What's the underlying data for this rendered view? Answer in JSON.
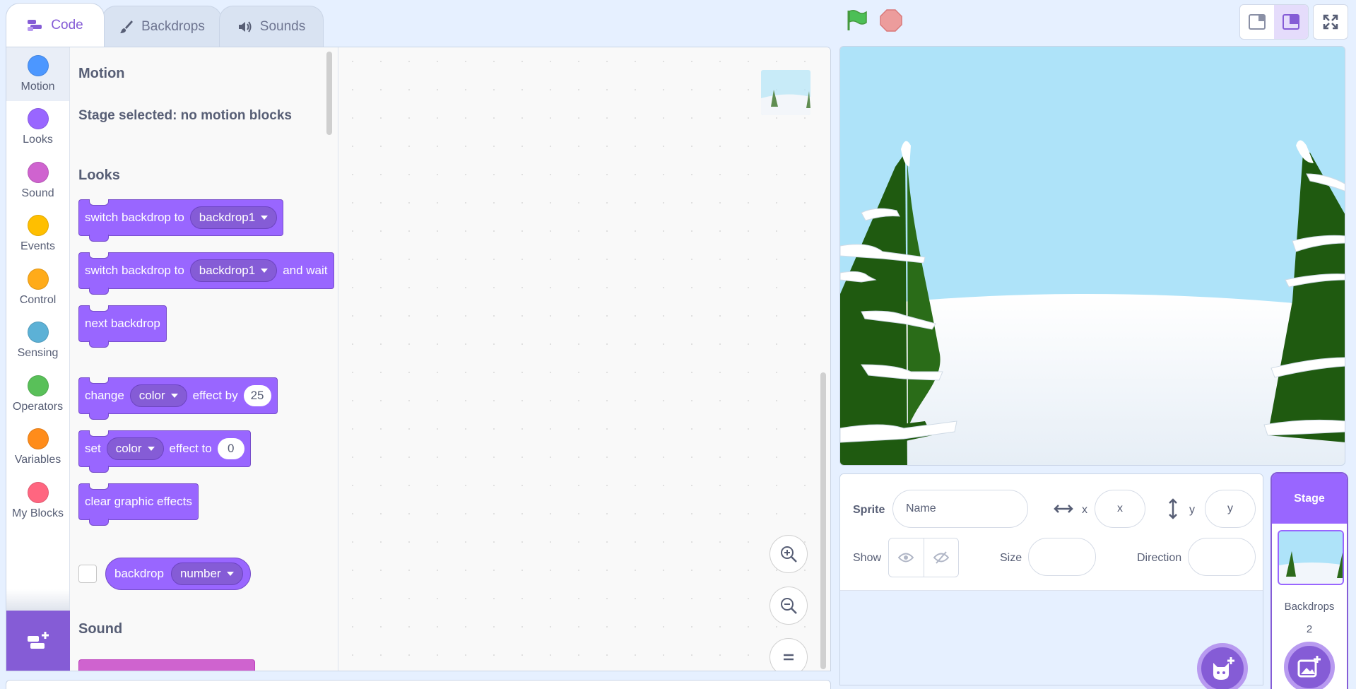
{
  "tabs": [
    {
      "label": "Code",
      "icon": "code-icon",
      "active": true
    },
    {
      "label": "Backdrops",
      "icon": "brush-icon",
      "active": false
    },
    {
      "label": "Sounds",
      "icon": "speaker-icon",
      "active": false
    }
  ],
  "categories": [
    {
      "label": "Motion",
      "color": "#4c97ff"
    },
    {
      "label": "Looks",
      "color": "#9966ff"
    },
    {
      "label": "Sound",
      "color": "#cf63cf"
    },
    {
      "label": "Events",
      "color": "#ffbf00"
    },
    {
      "label": "Control",
      "color": "#ffab19"
    },
    {
      "label": "Sensing",
      "color": "#5cb1d6"
    },
    {
      "label": "Operators",
      "color": "#59c059"
    },
    {
      "label": "Variables",
      "color": "#ff8c1a"
    },
    {
      "label": "My Blocks",
      "color": "#ff6680"
    }
  ],
  "flyout": {
    "motion_title": "Motion",
    "motion_note": "Stage selected: no motion blocks",
    "looks_title": "Looks",
    "sound_title": "Sound",
    "blocks": {
      "switch_backdrop": {
        "text": "switch backdrop to",
        "menu": "backdrop1"
      },
      "switch_backdrop_wait": {
        "text": "switch backdrop to",
        "menu": "backdrop1",
        "suffix": "and wait"
      },
      "next_backdrop": {
        "text": "next backdrop"
      },
      "change_effect": {
        "text": "change",
        "menu": "color",
        "mid": "effect by",
        "value": "25"
      },
      "set_effect": {
        "text": "set",
        "menu": "color",
        "mid": "effect to",
        "value": "0"
      },
      "clear_effects": {
        "text": "clear graphic effects"
      },
      "backdrop_reporter": {
        "text": "backdrop",
        "menu": "number"
      }
    }
  },
  "sprite_info": {
    "sprite_label": "Sprite",
    "name_placeholder": "Name",
    "x_label": "x",
    "x_placeholder": "x",
    "y_label": "y",
    "y_placeholder": "y",
    "show_label": "Show",
    "size_label": "Size",
    "direction_label": "Direction"
  },
  "stage_selector": {
    "title": "Stage",
    "backdrops_label": "Backdrops",
    "backdrops_count": "2"
  },
  "colors": {
    "accent": "#855cd6",
    "looks": "#9966ff",
    "sound": "#cf63cf",
    "stop": "#ec9c9c",
    "flag": "#4cbf56"
  }
}
